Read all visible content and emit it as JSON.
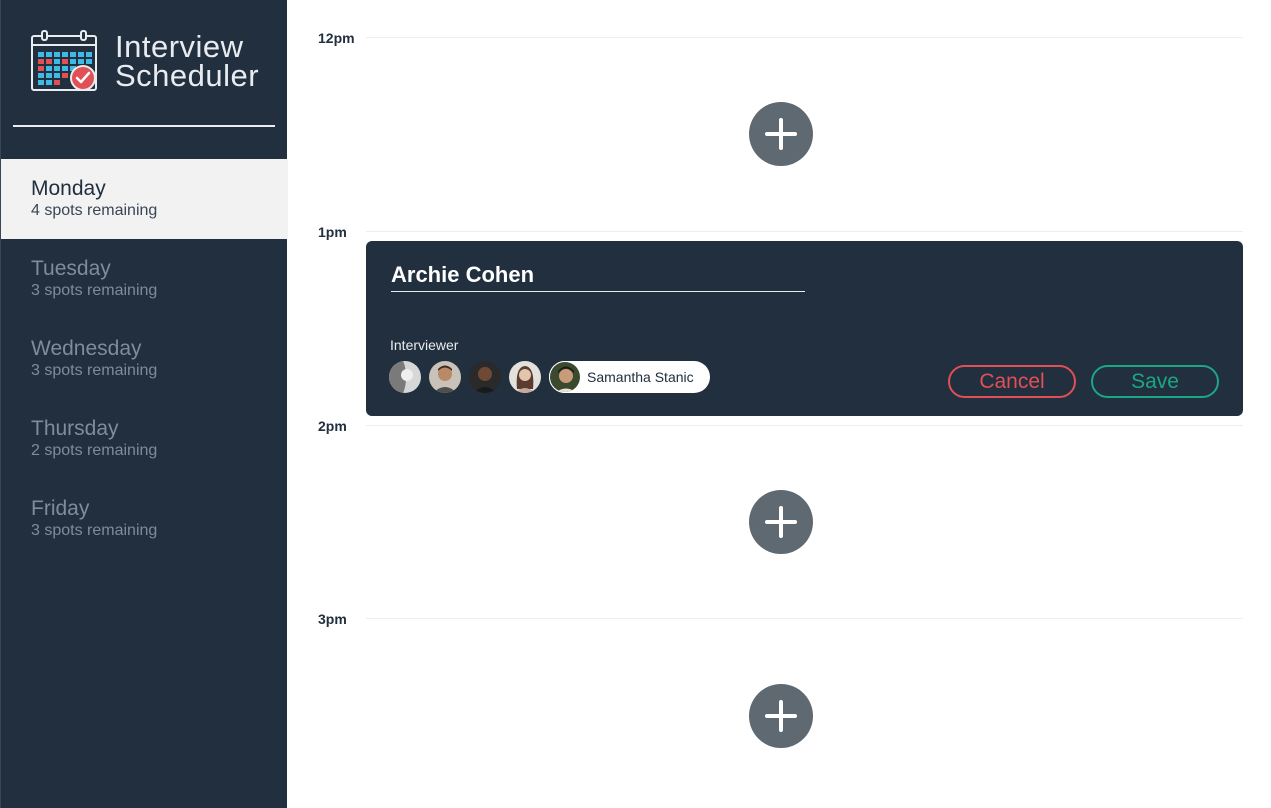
{
  "app": {
    "title_line1": "Interview",
    "title_line2": "Scheduler"
  },
  "days": [
    {
      "name": "Monday",
      "spots": "4 spots remaining",
      "selected": true
    },
    {
      "name": "Tuesday",
      "spots": "3 spots remaining",
      "selected": false
    },
    {
      "name": "Wednesday",
      "spots": "3 spots remaining",
      "selected": false
    },
    {
      "name": "Thursday",
      "spots": "2 spots remaining",
      "selected": false
    },
    {
      "name": "Friday",
      "spots": "3 spots remaining",
      "selected": false
    }
  ],
  "times": [
    "12pm",
    "1pm",
    "2pm",
    "3pm"
  ],
  "form": {
    "student_name": "Archie Cohen",
    "interviewer_label": "Interviewer",
    "selected_interviewer": "Samantha Stanic",
    "cancel_label": "Cancel",
    "save_label": "Save"
  },
  "colors": {
    "sidebar_bg": "#222f3e",
    "selected_day_bg": "#f2f2f2",
    "add_button": "#5e6972",
    "cancel": "#e05054",
    "save": "#1ba784"
  },
  "icons": {
    "logo": "calendar-check-icon",
    "add": "plus-icon"
  }
}
